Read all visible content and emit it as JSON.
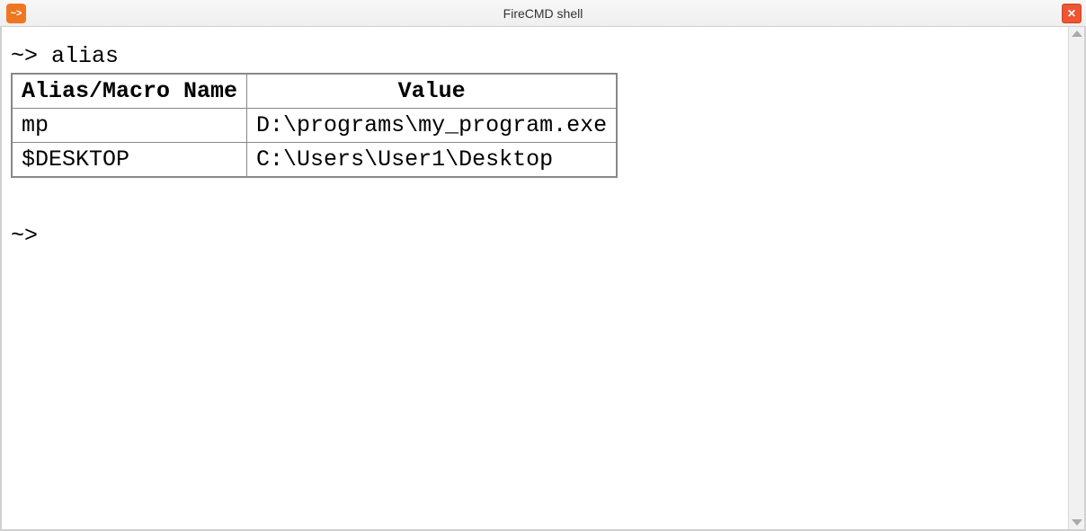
{
  "titlebar": {
    "app_icon_text": "~>",
    "title": "FireCMD shell",
    "close_glyph": "✕"
  },
  "terminal": {
    "prompt": "~>",
    "command": "alias",
    "table": {
      "headers": [
        "Alias/Macro Name",
        "Value"
      ],
      "rows": [
        {
          "name": "mp",
          "value": "D:\\programs\\my_program.exe"
        },
        {
          "name": "$DESKTOP",
          "value": "C:\\Users\\User1\\Desktop"
        }
      ]
    },
    "prompt2": "~>"
  }
}
